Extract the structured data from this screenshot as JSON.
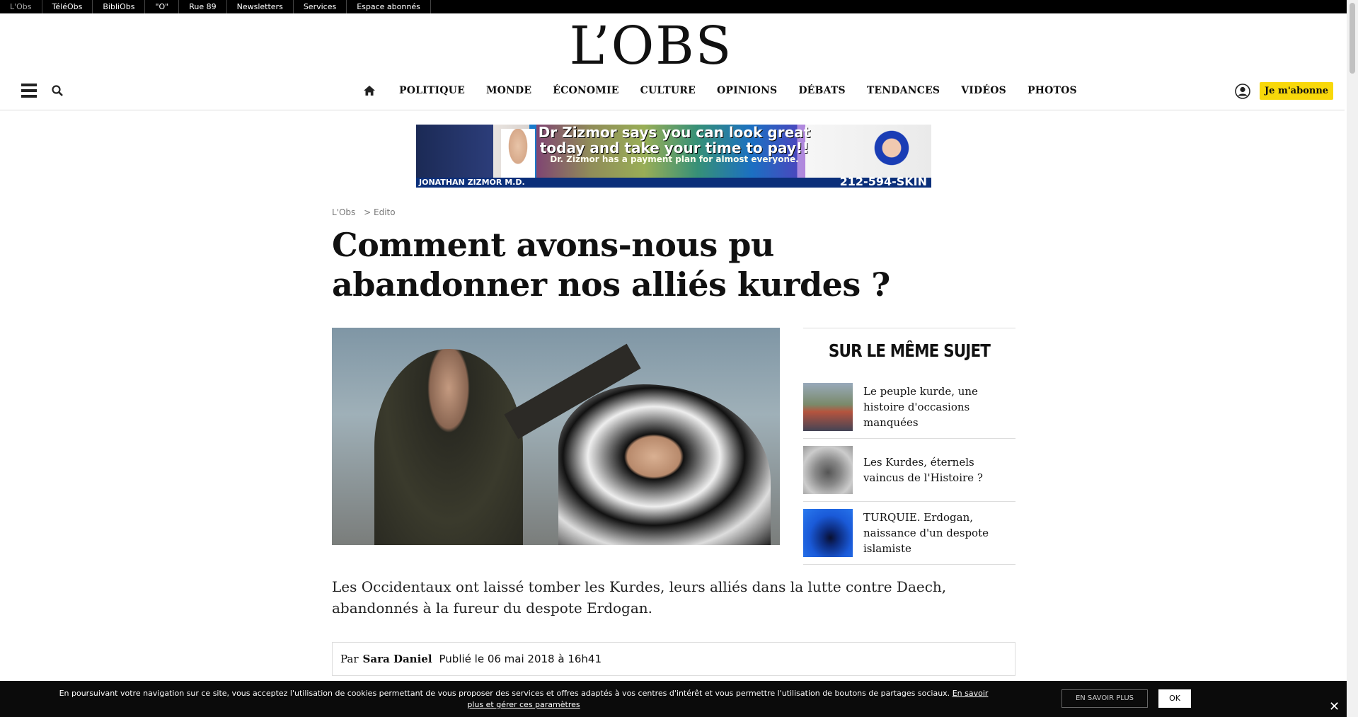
{
  "topbar": {
    "links": [
      "L'Obs",
      "TéléObs",
      "BibliObs",
      "\"O\"",
      "Rue 89",
      "Newsletters",
      "Services",
      "Espace abonnés"
    ]
  },
  "header": {
    "logo": "L’OBS",
    "nav": [
      "POLITIQUE",
      "MONDE",
      "ÉCONOMIE",
      "CULTURE",
      "OPINIONS",
      "DÉBATS",
      "TENDANCES",
      "VIDÉOS",
      "PHOTOS"
    ],
    "subscribe": "Je m'abonne"
  },
  "ad": {
    "headline": "Dr Zizmor says you can look great today and take your time to pay!!",
    "subline": "Dr. Zizmor has a payment plan for almost everyone.",
    "name": "JONATHAN ZIZMOR M.D.",
    "phone": "212-594-SKIN"
  },
  "article": {
    "breadcrumb": [
      "L'Obs",
      "> Edito"
    ],
    "title": "Comment avons-nous pu abandonner nos alliés kurdes ?",
    "lede": "Les Occidentaux ont laissé tomber les Kurdes, leurs alliés dans la lutte contre Daech, abandonnés à la fureur du despote Erdogan.",
    "byline_prefix": "Par",
    "author": "Sara Daniel",
    "published": "Publié le 06 mai 2018 à 16h41"
  },
  "aside": {
    "heading": "SUR LE MÊME SUJET",
    "items": [
      {
        "text": "Le peuple kurde, une histoire d'occasions manquées"
      },
      {
        "text": "Les Kurdes, éternels vaincus de l'Histoire ?"
      },
      {
        "text": "TURQUIE. Erdogan, naissance d'un despote islamiste"
      }
    ]
  },
  "cookie": {
    "message": "En poursuivant votre navigation sur ce site, vous acceptez l'utilisation de cookies permettant de vous proposer des services et offres adaptés à vos centres d'intérêt et vous permettre l'utilisation de boutons de partages sociaux.",
    "link": "En savoir plus et gérer ces paramètres",
    "more_button": "EN SAVOIR PLUS",
    "ok_button": "OK",
    "close": "✕"
  },
  "icons": {
    "menu": "menu-icon",
    "search": "search-icon",
    "home": "home-icon",
    "user": "user-icon"
  },
  "colors": {
    "subscribe_bg": "#f8d80a",
    "topbar_bg": "#000000",
    "cookie_bg": "#0b0b0b"
  }
}
